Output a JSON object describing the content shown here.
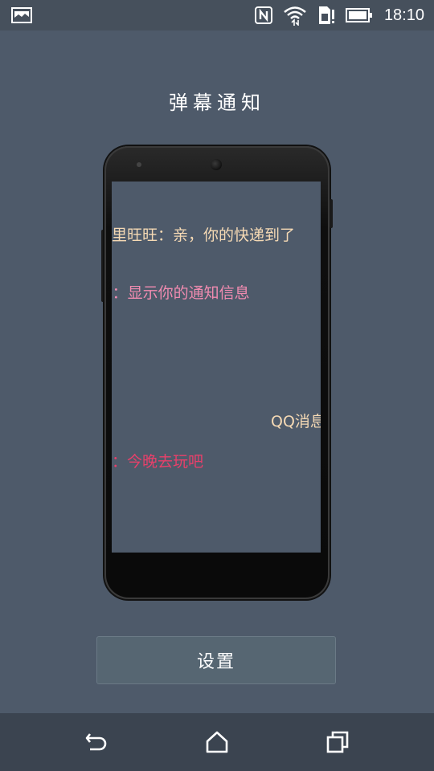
{
  "status_bar": {
    "time": "18:10",
    "icons": [
      "image-icon",
      "nfc-icon",
      "wifi-icon",
      "sim-alert-icon",
      "battery-icon"
    ]
  },
  "title": "弹幕通知",
  "danmaku": [
    {
      "text": "里旺旺：亲，你的快递到了",
      "color": "#f5d9b4"
    },
    {
      "text": "I：显示你的通知信息",
      "color": "#f08bb0"
    },
    {
      "text": "QQ消息",
      "color": "#f5d9b4"
    },
    {
      "text": "：今晚去玩吧",
      "color": "#e8406a"
    }
  ],
  "settings_button": {
    "label": "设置"
  },
  "nav_bar": {
    "icons": [
      "back-icon",
      "home-icon",
      "recents-icon"
    ]
  },
  "colors": {
    "background": "#4e5a6a",
    "status_bar": "#46505c",
    "nav_bar": "#3b4450",
    "button": "#566672"
  }
}
